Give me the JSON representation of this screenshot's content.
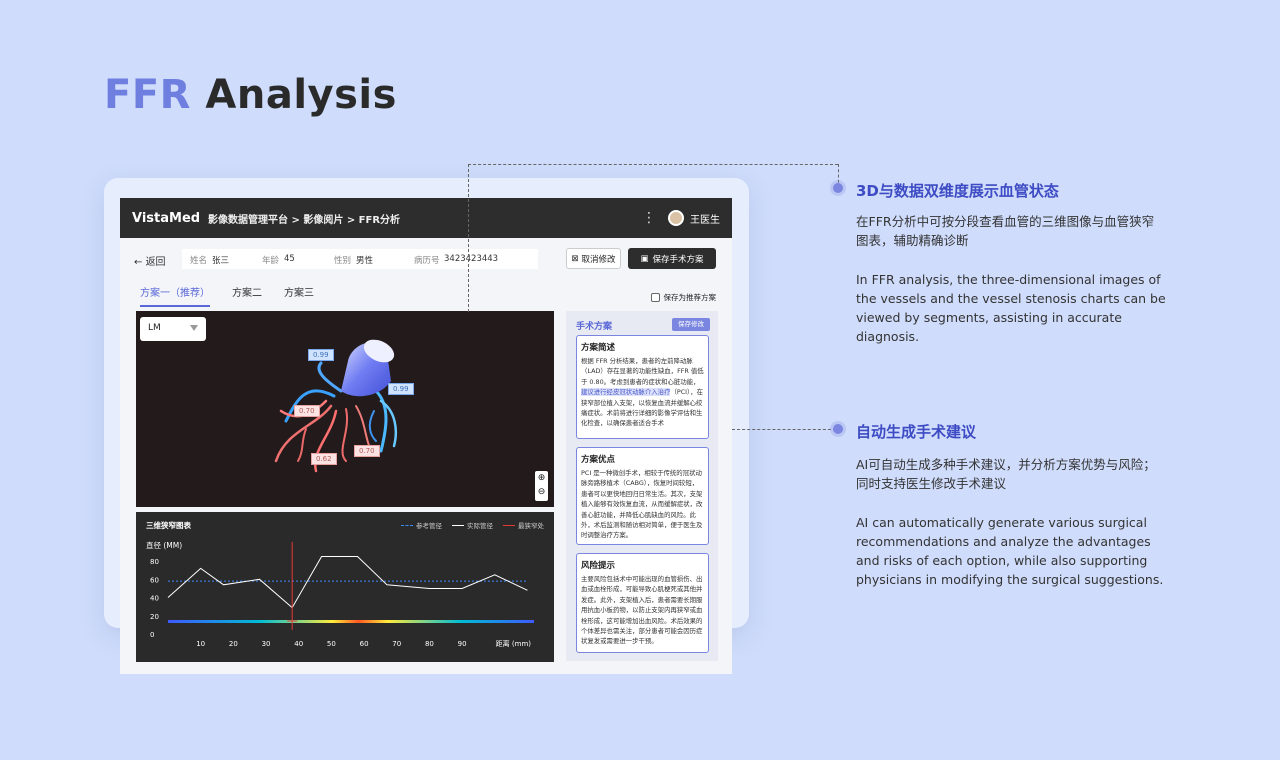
{
  "hero": {
    "accent": "FFR",
    "rest": "Analysis"
  },
  "app": {
    "brand": "VistaMed",
    "breadcrumb": "影像数据管理平台 > 影像阅片 > FFR分析",
    "user": "王医生",
    "back": "返回",
    "patient": {
      "name_label": "姓名",
      "name": "张三",
      "age_label": "年龄",
      "age": "45",
      "gender_label": "性别",
      "gender": "男性",
      "record_label": "病历号",
      "record": "3423423443"
    },
    "cancel_label": "取消修改",
    "save_plan_label": "保存手术方案",
    "tabs": [
      "方案一（推荐）",
      "方案二",
      "方案三"
    ],
    "recommend_label": "保存为推荐方案",
    "segment": "LM",
    "tags": [
      "0.99",
      "0.99",
      "0.70",
      "0.62",
      "0.70"
    ]
  },
  "chart_data": {
    "type": "line",
    "title": "三维狭窄图表",
    "ylabel": "直径 (MM)",
    "xlabel": "距离 (mm)",
    "x": [
      0,
      10,
      17,
      28,
      38,
      47,
      58,
      67,
      80,
      90,
      100,
      110
    ],
    "xticks": [
      10,
      20,
      30,
      40,
      50,
      60,
      70,
      80,
      90
    ],
    "yticks": [
      0,
      20,
      40,
      60,
      80
    ],
    "xlim": [
      0,
      112
    ],
    "ylim": [
      0,
      90
    ],
    "series": [
      {
        "name": "参考管径",
        "style": "dashed",
        "color": "#3d8bff",
        "values": [
          58,
          58,
          58,
          58,
          58,
          58,
          58,
          58,
          58,
          58,
          58,
          58
        ]
      },
      {
        "name": "实际管径",
        "style": "solid",
        "color": "#ffffff",
        "values": [
          40,
          72,
          54,
          60,
          29,
          85,
          85,
          54,
          50,
          50,
          65,
          48
        ]
      }
    ],
    "min_marker": {
      "name": "最狭窄处",
      "x": 38,
      "color": "#e53935"
    },
    "grid": false,
    "legend": "top-right"
  },
  "plan": {
    "title": "手术方案",
    "edit_label": "保存修改",
    "overview": {
      "heading": "方案简述",
      "before": "根据 FFR 分析结果，患者的左前降动脉（LAD）存在显著的功能性缺血，FFR 值低于 0.80。考虑到患者的症状和心脏功能，",
      "highlight": "建议进行经皮冠状动脉介入治疗",
      "after": "（PCI），在狭窄部位植入支架，以恢复血流并缓解心绞痛症状。术前将进行详细的影像学评估和生化检查，以确保患者适合手术"
    },
    "advantages": {
      "heading": "方案优点",
      "body": "PCI 是一种微创手术，相较于传统的冠状动脉旁路移植术（CABG），恢复时间较短，患者可以更快地回归日常生活。其次，支架植入能够有效恢复血流，从而缓解症状，改善心脏功能，并降低心肌缺血的风险。此外，术后监测和随访相对简单，便于医生及时调整治疗方案。"
    },
    "risks": {
      "heading": "风险提示",
      "body": "主要风险包括术中可能出现的血管损伤、出血或血栓形成，可能导致心肌梗死或其他并发症。此外，支架植入后，患者需要长期服用抗血小板药物，以防止支架内再狭窄或血栓形成，这可能增加出血风险。术后效果的个体差异也需关注，部分患者可能会因历症状复发或需要进一步干预。"
    }
  },
  "features": [
    {
      "title": "3D与数据双维度展示血管状态",
      "cn": "在FFR分析中可按分段查看血管的三维图像与血管狭窄图表，辅助精确诊断",
      "en": "In FFR analysis, the three-dimensional images of the vessels and the vessel stenosis charts can be viewed by segments, assisting in accurate diagnosis."
    },
    {
      "title": "自动生成手术建议",
      "cn": "AI可自动生成多种手术建议，并分析方案优势与风险；同时支持医生修改手术建议",
      "en": "AI can automatically generate various surgical recommendations and analyze the advantages and risks of each option, while also supporting physicians in modifying the surgical suggestions."
    }
  ]
}
